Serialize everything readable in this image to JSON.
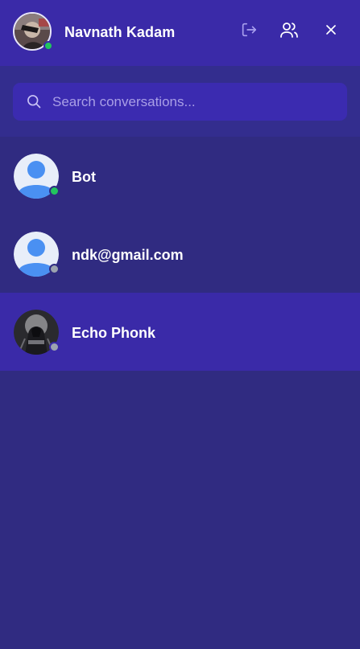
{
  "header": {
    "user_name": "Navnath Kadam",
    "user_status": "online",
    "icons": {
      "logout": "logout-icon",
      "users": "users-icon",
      "close": "close-icon"
    }
  },
  "search": {
    "placeholder": "Search conversations...",
    "value": "",
    "icon": "search-icon"
  },
  "conversations": [
    {
      "name": "Bot",
      "status": "online",
      "avatar": "default-user-avatar",
      "active": false
    },
    {
      "name": "ndk@gmail.com",
      "status": "offline",
      "avatar": "default-user-avatar",
      "active": false
    },
    {
      "name": "Echo Phonk",
      "status": "offline",
      "avatar": "hooded-figure-photo",
      "active": true
    }
  ],
  "colors": {
    "header_bg": "#3a2aa8",
    "panel_bg": "#302b81",
    "search_bg": "#3b2bb0",
    "active_row_bg": "#3a2aa8",
    "online": "#22c55e",
    "offline": "#9ca3af",
    "avatar_blue": "#4a90f2",
    "avatar_bg": "#e8eef9"
  }
}
